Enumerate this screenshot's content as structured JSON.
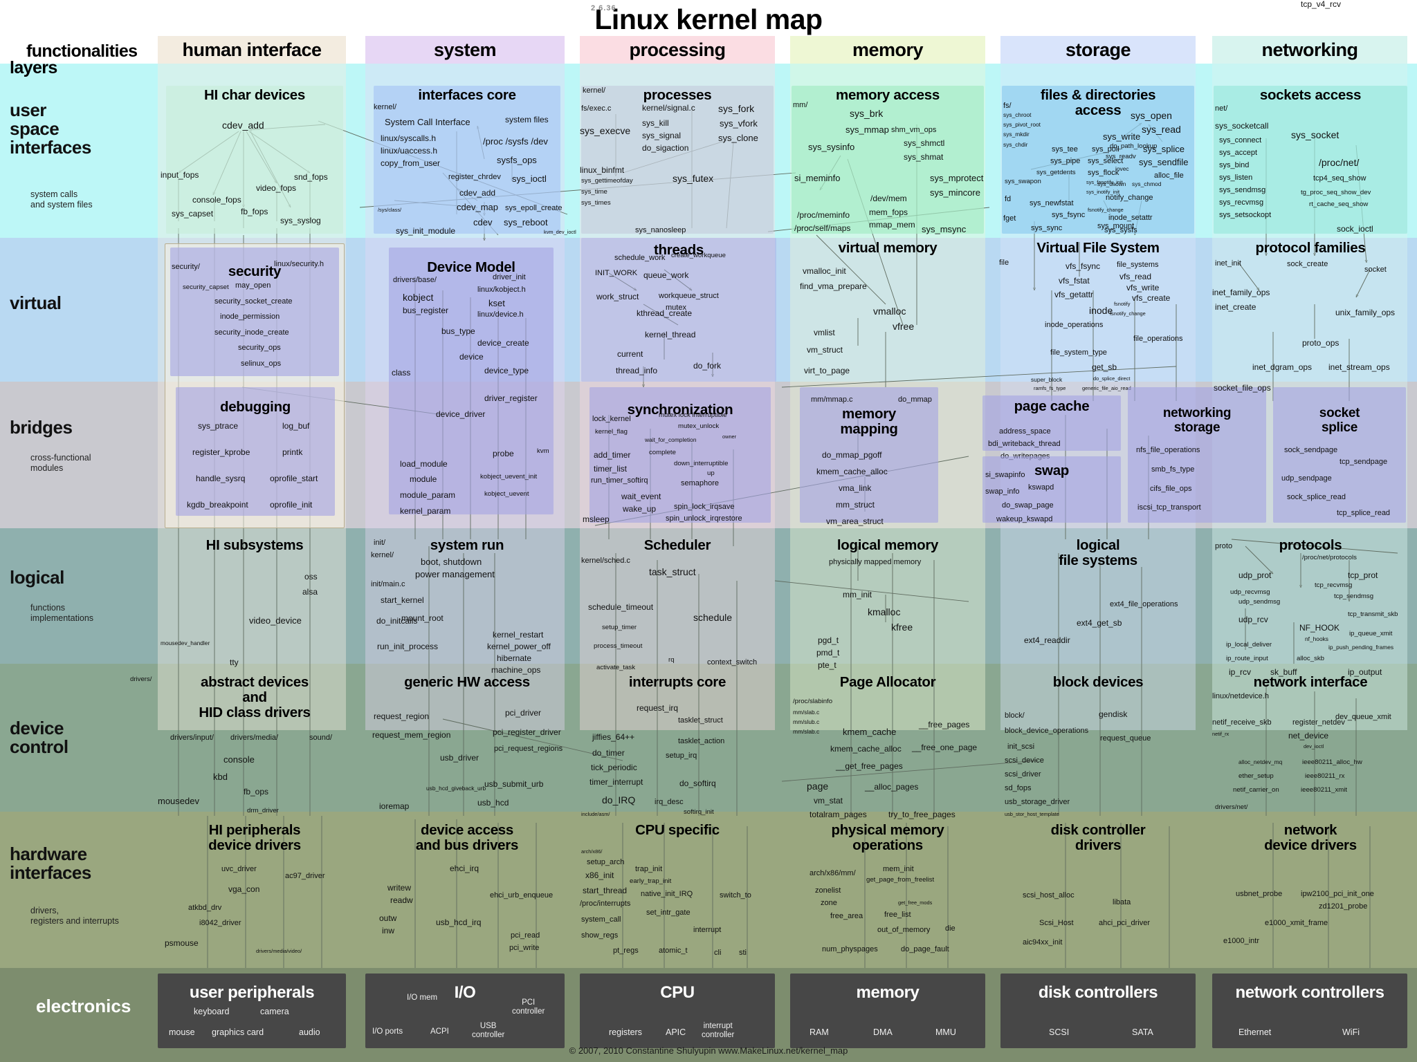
{
  "title": "Linux kernel map",
  "version": "2.6.36",
  "copyright": "© 2007, 2010 Constantine Shulyupin www.MakeLinux.net/kernel_map",
  "axes": {
    "functionalities": "functionalities",
    "layers": "layers"
  },
  "colors": {
    "human_interface": "#f3ece0",
    "system": "#e7d7f5",
    "processing": "#fbdde3",
    "memory": "#eef7d4",
    "storage": "#d9e4fb",
    "networking": "#d8f4ef",
    "user_space": "#bdf7f7",
    "virtual": "#b9d9f2",
    "bridges": "#c9c9cf",
    "logical": "#8fb0ae",
    "device_control": "#8aa791",
    "hardware": "#9aa77f",
    "electronics": "#7d8d6e",
    "elec_box": "#474747",
    "arrow": "#5f6b5f"
  },
  "columns": [
    {
      "id": "human-interface",
      "label": "human interface"
    },
    {
      "id": "system",
      "label": "system"
    },
    {
      "id": "processing",
      "label": "processing"
    },
    {
      "id": "memory",
      "label": "memory"
    },
    {
      "id": "storage",
      "label": "storage"
    },
    {
      "id": "networking",
      "label": "networking"
    }
  ],
  "layers": [
    {
      "id": "user-space",
      "label": "user\nspace\ninterfaces",
      "sub": "system calls\nand system files"
    },
    {
      "id": "virtual",
      "label": "virtual",
      "sub": ""
    },
    {
      "id": "bridges",
      "label": "bridges",
      "sub": "cross-functional\nmodules"
    },
    {
      "id": "logical",
      "label": "logical",
      "sub": "functions\nimplementations"
    },
    {
      "id": "device-control",
      "label": "device\ncontrol",
      "sub": ""
    },
    {
      "id": "hardware-interfaces",
      "label": "hardware\ninterfaces",
      "sub": "drivers,\nregisters and interrupts"
    },
    {
      "id": "electronics",
      "label": "electronics",
      "sub": ""
    }
  ],
  "boxes": {
    "hi_char_devices": {
      "title": "HI char devices",
      "symbols": [
        "cdev_add",
        "input_fops",
        "console_fops",
        "video_fops",
        "snd_fops",
        "fb_fops",
        "sys_capset",
        "sys_syslog"
      ]
    },
    "interfaces_core": {
      "title": "interfaces core",
      "symbols": [
        "kernel/",
        "System Call Interface",
        "linux/syscalls.h",
        "linux/uaccess.h",
        "copy_from_user",
        "system files",
        "/proc  /sysfs  /dev",
        "sysfs_ops",
        "register_chrdev",
        "sys_ioctl",
        "cdev_add",
        "cdev_map",
        "cdev",
        "sys_epoll_create",
        "sys_reboot",
        "kvm_dev_ioctl",
        "/sys/class/",
        "sys_init_module"
      ]
    },
    "processes": {
      "title": "processes",
      "symbols": [
        "kernel/",
        "fs/exec.c",
        "sys_execve",
        "kernel/signal.c",
        "sys_kill",
        "sys_signal",
        "do_sigaction",
        "sys_fork",
        "sys_vfork",
        "sys_clone",
        "linux_binfmt",
        "sys_gettimeofday",
        "sys_time",
        "sys_times",
        "sys_futex",
        "sys_nanosleep"
      ]
    },
    "memory_access": {
      "title": "memory access",
      "symbols": [
        "mm/",
        "sys_brk",
        "sys_mmap",
        "shm_vm_ops",
        "sys_shmctl",
        "sys_shmat",
        "sys_sysinfo",
        "si_meminfo",
        "sys_mprotect",
        "sys_mincore",
        "/dev/mem",
        "mem_fops",
        "mmap_mem",
        "/proc/meminfo",
        "/proc/self/maps",
        "sys_msync"
      ]
    },
    "files_directories_access": {
      "title": "files & directories\naccess",
      "symbols": [
        "fs/",
        "sys_chroot",
        "sys_pivot_root",
        "sys_mkdir",
        "sys_chdir",
        "sys_tee",
        "sys_pipe",
        "sys_getdents",
        "sys_poll",
        "sys_select",
        "sys_flock",
        "sys_fanotify_init",
        "sys_inotify_init",
        "sys_open",
        "sys_read",
        "sys_write",
        "sys_readv",
        "do_path_lookup",
        "iovec",
        "alloc_file",
        "sys_splice",
        "sys_sendfile",
        "sys_chown",
        "sys_chmod",
        "notify_change",
        "fsnotify_change",
        "inode_setattr",
        "sys_sysfs",
        "sys_swapon",
        "fd",
        "fget",
        "sys_newfstat",
        "sys_fsync",
        "sys_sync",
        "sys_mount"
      ]
    },
    "sockets_access": {
      "title": "sockets access",
      "symbols": [
        "net/",
        "sys_socketcall",
        "sys_connect",
        "sys_accept",
        "sys_bind",
        "sys_listen",
        "sys_sendmsg",
        "sys_recvmsg",
        "sys_setsockopt",
        "sys_socket",
        "/proc/net/",
        "tcp4_seq_show",
        "tg_proc_seq_show_dev",
        "rt_cache_seq_show",
        "sock_ioctl"
      ]
    },
    "security": {
      "title": "security",
      "symbols": [
        "security/",
        "linux/security.h",
        "security_capset",
        "may_open",
        "security_socket_create",
        "inode_permission",
        "security_inode_create",
        "security_ops",
        "selinux_ops"
      ]
    },
    "debugging": {
      "title": "debugging",
      "symbols": [
        "sys_ptrace",
        "log_buf",
        "register_kprobe",
        "printk",
        "handle_sysrq",
        "oprofile_start",
        "kgdb_breakpoint",
        "oprofile_init"
      ]
    },
    "device_model": {
      "title": "Device Model",
      "symbols": [
        "drivers/base/",
        "driver_init",
        "kobject",
        "linux/kobject.h",
        "kset",
        "bus_register",
        "linux/device.h",
        "bus_type",
        "device_create",
        "device",
        "class",
        "device_type",
        "driver_register",
        "device_driver",
        "probe",
        "kvm",
        "load_module",
        "module",
        "module_param",
        "kernel_param",
        "kobject_uevent_init",
        "kobject_uevent"
      ]
    },
    "threads": {
      "title": "threads",
      "symbols": [
        "schedule_work",
        "create_workqueue",
        "INIT_WORK",
        "queue_work",
        "work_struct",
        "workqueue_struct",
        "mutex",
        "kthread_create",
        "kernel_thread",
        "current",
        "thread_info",
        "do_fork"
      ]
    },
    "virtual_memory": {
      "title": "virtual memory",
      "symbols": [
        "vmalloc_init",
        "find_vma_prepare",
        "vmalloc",
        "vfree",
        "vmlist",
        "vm_struct",
        "virt_to_page"
      ]
    },
    "virtual_file_system": {
      "title": "Virtual File System",
      "symbols": [
        "file_systems",
        "vfs_fsync",
        "vfs_read",
        "vfs_fstat",
        "vfs_write",
        "vfs_getattr",
        "vfs_create",
        "inode",
        "fsnotify",
        "fsnotify_change",
        "inode_operations",
        "file_operations",
        "file_system_type",
        "get_sb",
        "super_block",
        "do_splice_direct",
        "ramfs_fs_type",
        "generic_file_aio_read",
        "file"
      ]
    },
    "protocol_families": {
      "title": "protocol families",
      "symbols": [
        "inet_init",
        "sock_create",
        "socket",
        "inet_family_ops",
        "inet_create",
        "unix_family_ops",
        "proto_ops",
        "inet_dgram_ops",
        "inet_stream_ops",
        "socket_file_ops"
      ]
    },
    "synchronization": {
      "title": "synchronization",
      "symbols": [
        "lock_kernel",
        "mutex  lock  interruptible",
        "mutex_unlock",
        "kernel_flag",
        "wait_for_completion",
        "complete",
        "owner",
        "add_timer",
        "timer_list",
        "run_timer_softirq",
        "down_interruptible",
        "up",
        "semaphore",
        "wait_event",
        "wake_up",
        "spin_lock_irqsave",
        "spin_unlock_irqrestore",
        "msleep"
      ]
    },
    "memory_mapping": {
      "title": "memory\nmapping",
      "symbols": [
        "mm/mmap.c",
        "do_mmap",
        "do_mmap_pgoff",
        "kmem_cache_alloc",
        "vma_link",
        "mm_struct",
        "vm_area_struct"
      ]
    },
    "page_cache": {
      "title": "page cache",
      "symbols": [
        "address_space",
        "bdi_writeback_thread",
        "do_writepages"
      ]
    },
    "swap": {
      "title": "swap",
      "symbols": [
        "si_swapinfo",
        "swap_info",
        "kswapd",
        "do_swap_page",
        "wakeup_kswapd"
      ]
    },
    "networking_storage": {
      "title": "networking\nstorage",
      "symbols": [
        "nfs_file_operations",
        "smb_fs_type",
        "cifs_file_ops",
        "iscsi_tcp_transport"
      ]
    },
    "socket_splice": {
      "title": "socket\nsplice",
      "symbols": [
        "sock_sendpage",
        "tcp_sendpage",
        "udp_sendpage",
        "sock_splice_read",
        "tcp_splice_read"
      ]
    },
    "hi_subsystems": {
      "title": "HI subsystems",
      "symbols": [
        "oss",
        "alsa",
        "video_device",
        "mousedev_handler",
        "tty",
        "drivers/"
      ]
    },
    "system_run": {
      "title": "system run",
      "symbols": [
        "init/",
        "kernel/",
        "boot, shutdown",
        "power management",
        "init/main.c",
        "start_kernel",
        "do_initcalls",
        "mount_root",
        "run_init_process",
        "kernel_restart",
        "kernel_power_off",
        "hibernate",
        "machine_ops"
      ]
    },
    "scheduler": {
      "title": "Scheduler",
      "symbols": [
        "kernel/sched.c",
        "task_struct",
        "schedule_timeout",
        "schedule",
        "setup_timer",
        "process_timeout",
        "activate_task",
        "rq",
        "context_switch"
      ]
    },
    "logical_memory": {
      "title": "logical memory",
      "symbols": [
        "physically mapped memory",
        "mm_init",
        "kmalloc",
        "kfree",
        "pgd_t",
        "pmd_t",
        "pte_t"
      ]
    },
    "logical_file_systems": {
      "title": "logical\nfile systems",
      "symbols": [
        "ext4_file_operations",
        "ext4_get_sb",
        "ext4_readdir"
      ]
    },
    "protocols": {
      "title": "protocols",
      "symbols": [
        "proto",
        "/proc/net/protocols",
        "udp_prot",
        "tcp_prot",
        "udp_recvmsg",
        "tcp_recvmsg",
        "udp_sendmsg",
        "tcp_sendmsg",
        "udp_rcv",
        "tcp_v4_rcv",
        "tcp_transmit_skb",
        "NF_HOOK",
        "nf_hooks",
        "ip_queue_xmit",
        "ip_local_deliver",
        "ip_push_pending_frames",
        "ip_route_input",
        "alloc_skb",
        "ip_rcv",
        "sk_buff",
        "ip_output"
      ]
    },
    "abstract_devices": {
      "title": "abstract devices\nand\nHID class drivers",
      "symbols": [
        "drivers/input/",
        "drivers/media/",
        "sound/",
        "console",
        "kbd",
        "fb_ops",
        "mousedev",
        "drm_driver"
      ]
    },
    "generic_hw_access": {
      "title": "generic HW access",
      "symbols": [
        "request_region",
        "request_mem_region",
        "pci_driver",
        "pci_register_driver",
        "pci_request_regions",
        "usb_driver",
        "usb_submit_urb",
        "usb_hcd_giveback_urb",
        "usb_hcd",
        "ioremap"
      ]
    },
    "interrupts_core": {
      "title": "interrupts core",
      "symbols": [
        "request_irq",
        "tasklet_struct",
        "tasklet_action",
        "jiffies_64++",
        "do_timer",
        "tick_periodic",
        "timer_interrupt",
        "setup_irq",
        "do_IRQ",
        "irq_desc",
        "do_softirq",
        "softirq_init",
        "include/asm/"
      ]
    },
    "page_allocator": {
      "title": "Page Allocator",
      "symbols": [
        "/proc/slabinfo",
        "mm/slab.c",
        "mm/slub.c",
        "mm/slab.c",
        "kmem_cache",
        "kmem_cache_alloc",
        "__free_pages",
        "__free_one_page",
        "__get_free_pages",
        "page",
        "__alloc_pages",
        "vm_stat",
        "totalram_pages",
        "try_to_free_pages"
      ]
    },
    "block_devices": {
      "title": "block devices",
      "symbols": [
        "block/",
        "block_device_operations",
        "gendisk",
        "init_scsi",
        "scsi_device",
        "scsi_driver",
        "sd_fops",
        "usb_storage_driver",
        "usb_stor_host_template",
        "request_queue"
      ]
    },
    "network_interface": {
      "title": "network interface",
      "symbols": [
        "linux/netdevice.h",
        "netif_receive_skb",
        "net_device",
        "netif_rx",
        "dev_queue_xmit",
        "register_netdev",
        "dev_ioctl",
        "alloc_netdev_mq",
        "ether_setup",
        "netif_carrier_on",
        "ieee80211_alloc_hw",
        "ieee80211_rx",
        "ieee80211_xmit",
        "drivers/net/"
      ]
    },
    "hi_peripherals": {
      "title": "HI peripherals\ndevice drivers",
      "symbols": [
        "uvc_driver",
        "ac97_driver",
        "vga_con",
        "atkbd_drv",
        "i8042_driver",
        "psmouse",
        "drivers/media/video/"
      ]
    },
    "device_access_bus": {
      "title": "device access\nand bus drivers",
      "symbols": [
        "ehci_irq",
        "writew",
        "readw",
        "ehci_urb_enqueue",
        "outw",
        "inw",
        "usb_hcd_irq",
        "pci_read",
        "pci_write"
      ]
    },
    "cpu_specific": {
      "title": "CPU specific",
      "symbols": [
        "setup_arch",
        "x86_init",
        "trap_init",
        "early_trap_init",
        "start_thread",
        "native_init_IRQ",
        "switch_to",
        "/proc/interrupts",
        "set_intr_gate",
        "system_call",
        "show_regs",
        "interrupt",
        "pt_regs",
        "atomic_t",
        "cli",
        "sti",
        "arch/x86/"
      ]
    },
    "physical_memory_ops": {
      "title": "physical memory\noperations",
      "symbols": [
        "arch/x86/mm/",
        "mem_init",
        "get_page_from_freelist",
        "zonelist",
        "zone",
        "free_area",
        "free_list",
        "get_free_mods",
        "out_of_memory",
        "die",
        "num_physpages",
        "do_page_fault"
      ]
    },
    "disk_controller_drivers": {
      "title": "disk controller\ndrivers",
      "symbols": [
        "scsi_host_alloc",
        "libata",
        "Scsi_Host",
        "ahci_pci_driver",
        "aic94xx_init"
      ]
    },
    "network_device_drivers": {
      "title": "network\ndevice drivers",
      "symbols": [
        "usbnet_probe",
        "ipw2100_pci_init_one",
        "zd1201_probe",
        "e1000_xmit_frame",
        "e1000_intr"
      ]
    }
  },
  "electronics": [
    {
      "id": "user-peripherals",
      "title": "user peripherals",
      "items": [
        "keyboard",
        "camera",
        "mouse",
        "graphics card",
        "audio"
      ]
    },
    {
      "id": "io",
      "title": "I/O",
      "items": [
        "I/O mem",
        "PCI controller",
        "I/O ports",
        "ACPI",
        "USB controller"
      ]
    },
    {
      "id": "cpu",
      "title": "CPU",
      "items": [
        "registers",
        "APIC",
        "interrupt controller"
      ]
    },
    {
      "id": "memory",
      "title": "memory",
      "items": [
        "RAM",
        "DMA",
        "MMU"
      ]
    },
    {
      "id": "disk-controllers",
      "title": "disk controllers",
      "items": [
        "SCSI",
        "SATA"
      ]
    },
    {
      "id": "network-controllers",
      "title": "network controllers",
      "items": [
        "Ethernet",
        "WiFi"
      ]
    }
  ]
}
